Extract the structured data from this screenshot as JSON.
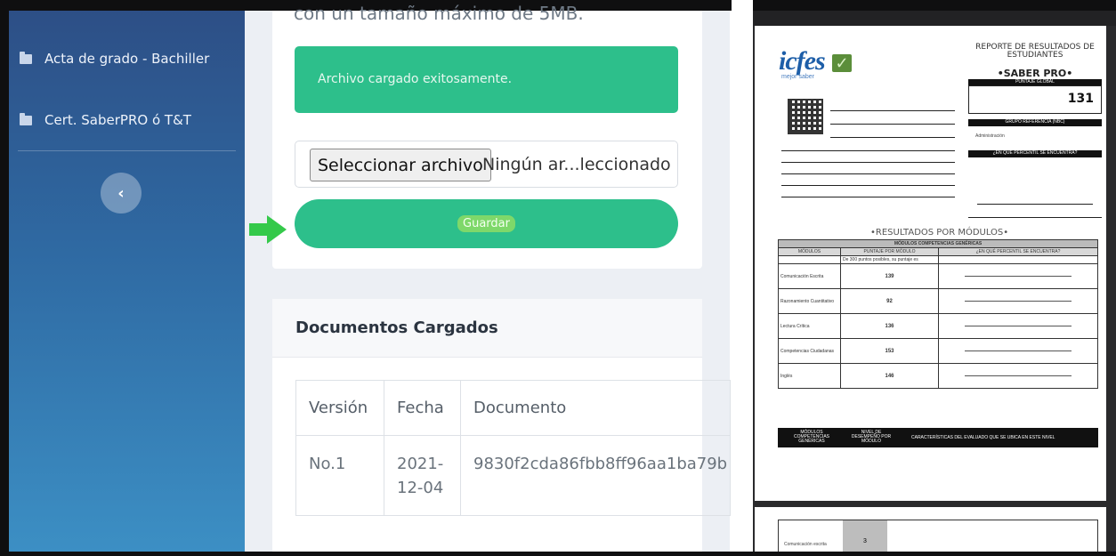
{
  "sidebar": {
    "items": [
      {
        "label": "Acta de grado - Bachiller",
        "icon": "folder-icon"
      },
      {
        "label": "Cert. SaberPRO ó T&T",
        "icon": "folder-icon"
      }
    ],
    "collapse_glyph": "‹"
  },
  "upload": {
    "cut_text": "con un tamaño máximo de 5MB.",
    "success_message": "Archivo cargado exitosamente.",
    "file_button_label": "Seleccionar archivo",
    "file_name": "Ningún ar...leccionado",
    "save_label": "Guardar"
  },
  "documents": {
    "title": "Documentos Cargados",
    "columns": [
      "Versión",
      "Fecha",
      "Documento"
    ],
    "rows": [
      {
        "version": "No.1",
        "fecha_1": "2021-",
        "fecha_2": "12-04",
        "documento": "9830f2cda86fbb8ff96aa1ba79b"
      }
    ]
  },
  "report": {
    "logo": "icfes",
    "logo_sub": "mejor saber",
    "title": "REPORTE DE RESULTADOS DE ESTUDIANTES",
    "subtitle": "•SABER PRO•",
    "puntaje_label": "PUNTAJE GLOBAL",
    "score": "131",
    "grupo_label": "GRUPO REFERENCIA (NBC)",
    "grupo_value": "Administración",
    "percentil_label": "¿EN QUÉ PERCENTIL SE ENCUENTRA?",
    "resultados_title": "•RESULTADOS POR MÓDULOS•",
    "table_header": "MÓDULOS COMPETENCIAS GENÉRICAS",
    "col_headers": [
      "MÓDULOS",
      "PUNTAJE POR MÓDULO",
      "¿EN QUÉ PERCENTIL SE ENCUENTRA?"
    ],
    "sub_header": "De 300 puntos posibles, su puntaje es",
    "modules": [
      {
        "name": "Comunicación Escrita",
        "score": "139"
      },
      {
        "name": "Razonamiento Cuantitativo",
        "score": "92"
      },
      {
        "name": "Lectura Crítica",
        "score": "136"
      },
      {
        "name": "Competencias Ciudadanas",
        "score": "153"
      },
      {
        "name": "Inglés",
        "score": "146"
      }
    ],
    "bottom_headers": [
      "MÓDULOS COMPETENCIAS GENÉRICAS",
      "NIVEL DE DESEMPEÑO POR MÓDULO",
      "CARACTERÍSTICAS DEL EVALUADO QUE SE UBICA EN ESTE NIVEL"
    ],
    "page2_module": "Comunicación escrita",
    "page2_level": "3"
  },
  "colors": {
    "sidebar_top": "#2d4f86",
    "sidebar_bottom": "#3c8fc4",
    "accent_green": "#2dbf8b",
    "arrow_green": "#34c94a"
  }
}
